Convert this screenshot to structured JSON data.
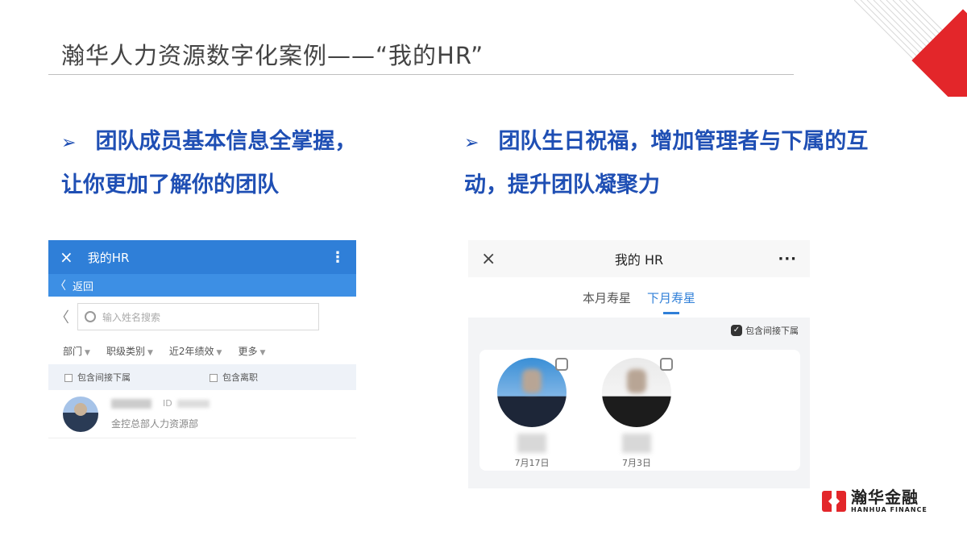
{
  "slide": {
    "title": "瀚华人力资源数字化案例——“我的HR”",
    "bullet_left": "团队成员基本信息全掌握，让你更加了解你的团队",
    "bullet_right": "团队生日祝福，增加管理者与下属的互动，提升团队凝聚力",
    "bullet_marker": "➢"
  },
  "left_app": {
    "topbar_title": "我的HR",
    "close_icon": "×",
    "menu_icon": "⋮",
    "back_label": "返回",
    "search_placeholder": "输入姓名搜索",
    "filters": [
      "部门",
      "职级类别",
      "近2年绩效",
      "更多"
    ],
    "checkbox_indirect": "包含间接下属",
    "checkbox_resigned": "包含离职",
    "person": {
      "id_label": "ID",
      "department": "金控总部人力资源部"
    }
  },
  "right_app": {
    "topbar_title": "我的 HR",
    "close_icon": "×",
    "more_icon": "···",
    "tabs": [
      "本月寿星",
      "下月寿星"
    ],
    "active_tab": "下月寿星",
    "option_label": "包含间接下属",
    "people": [
      {
        "date": "7月17日"
      },
      {
        "date": "7月3日"
      }
    ]
  },
  "logo": {
    "cn": "瀚华金融",
    "en": "HANHUA FINANCE",
    "brand_color": "#e3262a"
  },
  "colors": {
    "accent_blue": "#1f4fb4",
    "app_blue": "#2f7fd8"
  }
}
